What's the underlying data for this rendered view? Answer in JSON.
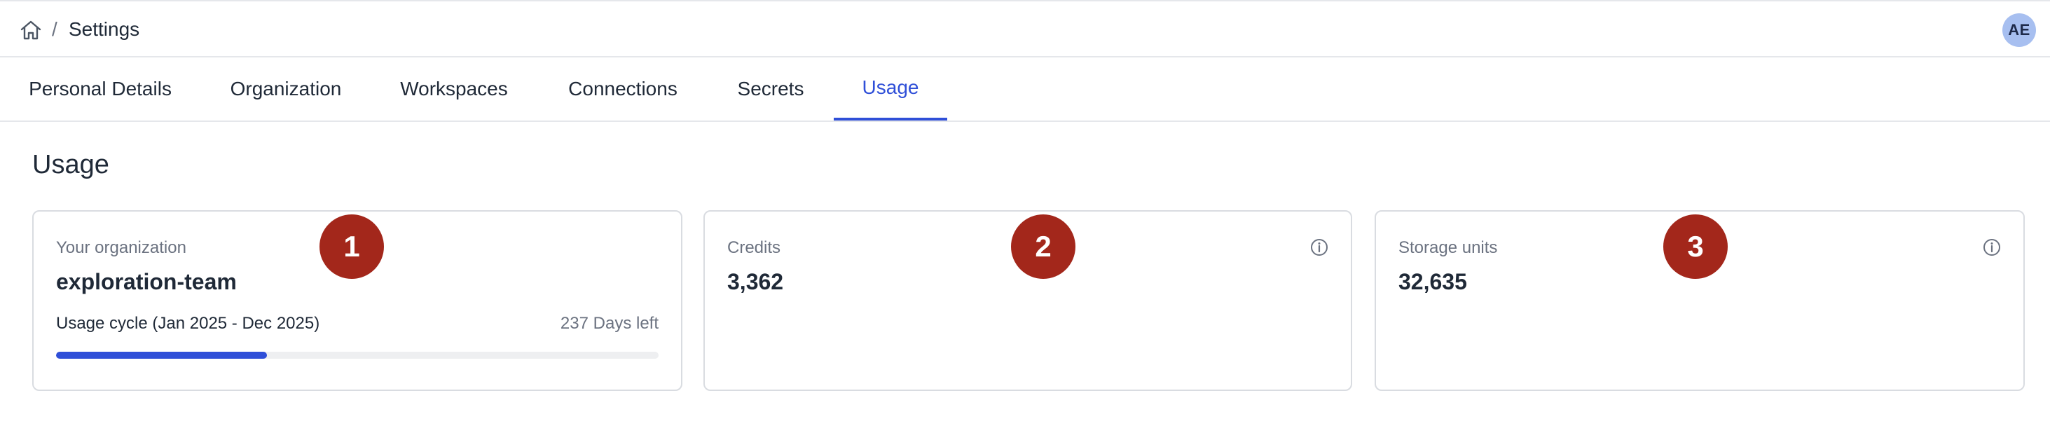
{
  "breadcrumb": {
    "home_icon": "home-icon",
    "separator": "/",
    "current": "Settings"
  },
  "user": {
    "initials": "AE"
  },
  "tabs": [
    {
      "label": "Personal Details",
      "active": false
    },
    {
      "label": "Organization",
      "active": false
    },
    {
      "label": "Workspaces",
      "active": false
    },
    {
      "label": "Connections",
      "active": false
    },
    {
      "label": "Secrets",
      "active": false
    },
    {
      "label": "Usage",
      "active": true
    }
  ],
  "page": {
    "title": "Usage"
  },
  "cards": {
    "organization": {
      "label": "Your organization",
      "value": "exploration-team",
      "cycle_label": "Usage cycle (Jan 2025 - Dec 2025)",
      "days_left": "237 Days left",
      "progress_fraction": 0.35
    },
    "credits": {
      "label": "Credits",
      "value": "3,362",
      "info_icon": "info-icon"
    },
    "storage": {
      "label": "Storage units",
      "value": "32,635",
      "info_icon": "info-icon"
    }
  },
  "markers": [
    "1",
    "2",
    "3"
  ],
  "colors": {
    "accent": "#2f4fd8",
    "marker": "#a3271b",
    "avatar_bg": "#a7bff0"
  }
}
